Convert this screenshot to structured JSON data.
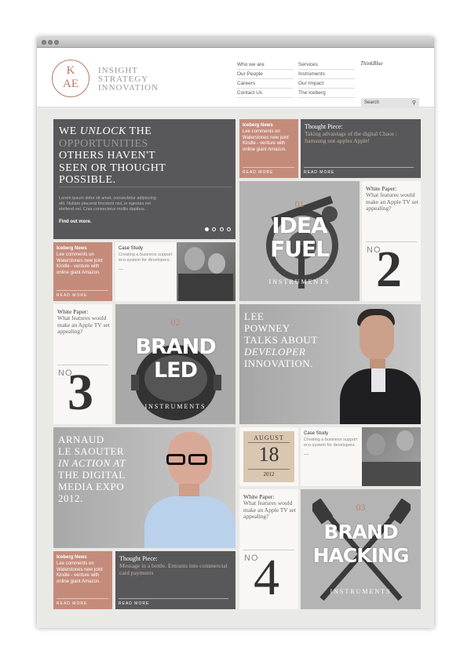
{
  "header": {
    "logo_k": "K",
    "logo_ae": "AE",
    "tagline": [
      "INSIGHT",
      "STRATEGY",
      "INNOVATION"
    ],
    "nav_col1": [
      "Who we are",
      "Our People",
      "Careers",
      "Contact Us"
    ],
    "nav_col2": [
      "Services",
      "Instruments",
      "Our Impact",
      "The Iceberg"
    ],
    "think_blue": "ThinkBlue",
    "search_placeholder": "Search"
  },
  "hero": {
    "line1a": "WE ",
    "line1b": "UNLOCK",
    "line1c": " THE",
    "line2": "OPPORTUNITIES",
    "line3": "OTHERS HAVEN'T",
    "line4": "SEEN OR THOUGHT",
    "line5": "POSSIBLE.",
    "body": "Lorem ipsum dolor sit amet, consectetur adipiscing elit. Nullam placerat tincidunt nisl, in egestas est eleifend vel. Cras consectetur mollis dapibus.",
    "find_out": "Find out more."
  },
  "iceberg_news": {
    "title": "Iceberg News",
    "body": "Lee comments on Waterstones new joint Kindle - venture with online giant Amazon.",
    "more": "READ MORE"
  },
  "thought_piece_1": {
    "title": "Thought Piece:",
    "body": "Taking advantage of the digital Chaos : Samsung out-apples Apple!",
    "more": "READ MORE"
  },
  "thought_piece_2": {
    "title": "Thought Piece:",
    "body": "Message in a bottle. Entrants into commercial card payments",
    "more": "READ MORE"
  },
  "idea_fuel": {
    "num": "01",
    "line1": "IDEA",
    "line2": "FUEL",
    "sub": "INSTRUMENTS"
  },
  "brand_led": {
    "num": "02",
    "line1": "BRAND",
    "line2": "LED",
    "sub": "INSTRUMENTS"
  },
  "brand_hacking": {
    "num": "03",
    "line1": "BRAND",
    "line2": "HACKING",
    "sub": "INSTRUMENTS"
  },
  "white_paper": {
    "title": "White Paper:",
    "body": "What features would make an Apple TV set appealing?",
    "no": "NO",
    "n2": "2",
    "n3": "3",
    "n4": "4"
  },
  "case_study": {
    "title": "Case Study",
    "body": "Creating a business support eco-system for developers.",
    "dash": "—"
  },
  "lee": {
    "l1": "LEE",
    "l2": "POWNEY",
    "l3": "TALKS ABOUT",
    "l4": "DEVELOPER",
    "l5": "INNOVATION."
  },
  "arnaud": {
    "l1": "ARNAUD",
    "l2": "LE SAOUTER",
    "l3": "IN ACTION AT",
    "l4": "THE DIGITAL",
    "l5": "MEDIA EXPO",
    "l6": "2012."
  },
  "date": {
    "month": "AUGUST",
    "day": "18",
    "year": "2012"
  }
}
